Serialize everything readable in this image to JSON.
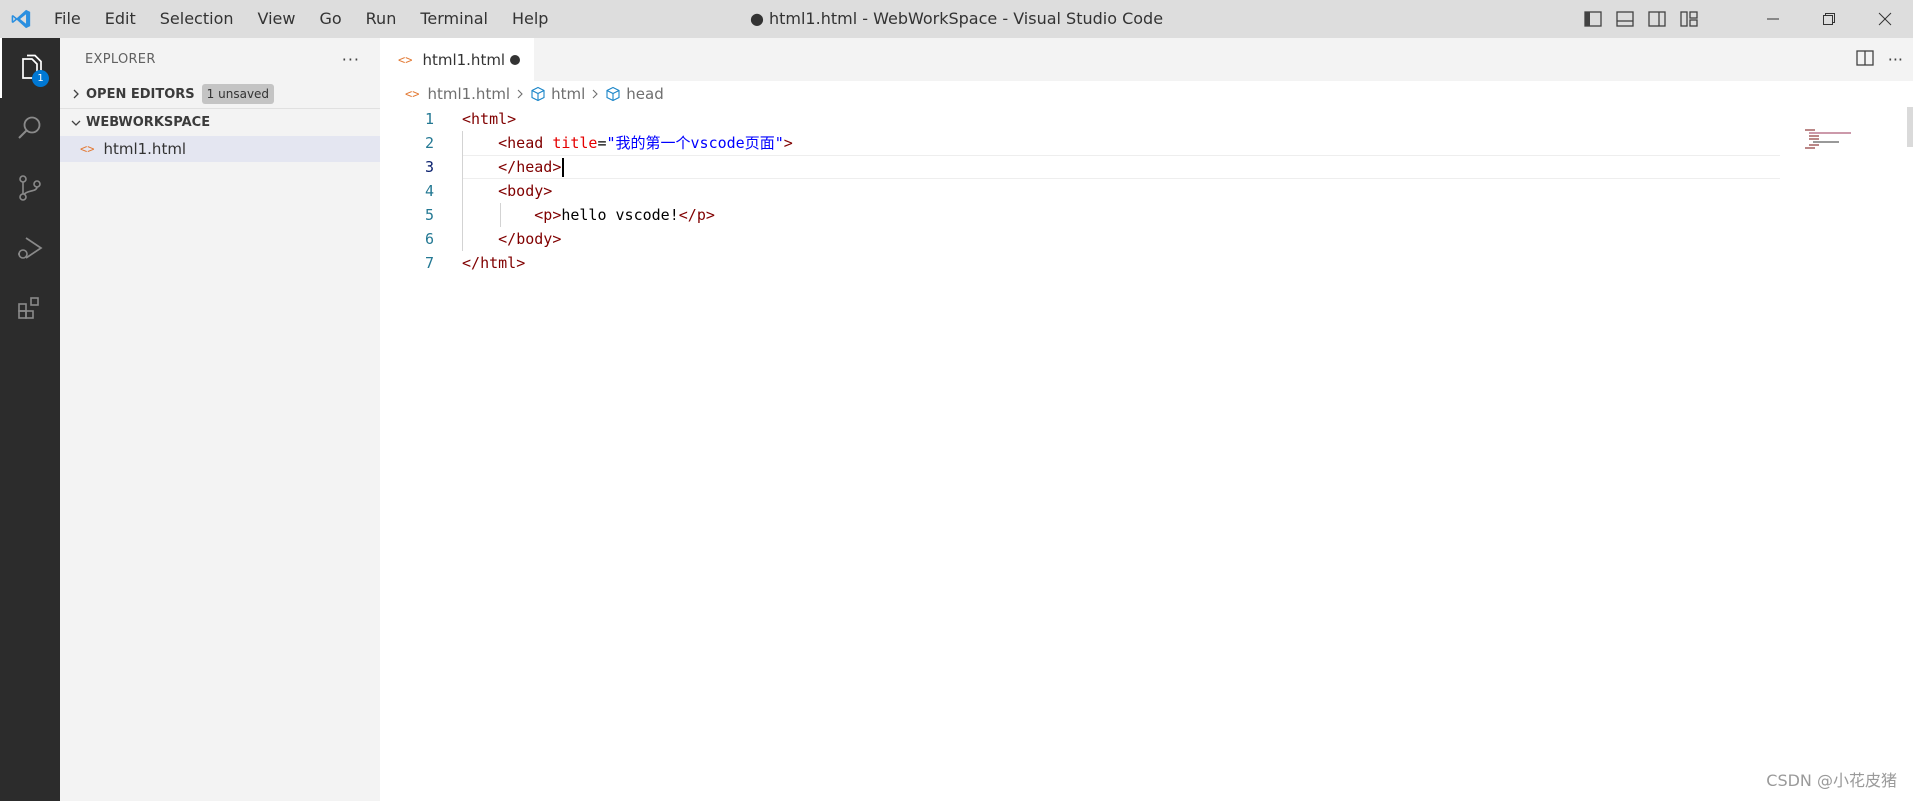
{
  "titlebar": {
    "menu": [
      "File",
      "Edit",
      "Selection",
      "View",
      "Go",
      "Run",
      "Terminal",
      "Help"
    ],
    "window_title": "● html1.html - WebWorkSpace - Visual Studio Code"
  },
  "activity_bar": {
    "items": [
      "explorer-icon",
      "search-icon",
      "source-control-icon",
      "run-debug-icon",
      "extensions-icon"
    ],
    "explorer_badge": "1"
  },
  "sidebar": {
    "title": "EXPLORER",
    "more": "···",
    "open_editors": {
      "label": "OPEN EDITORS",
      "badge": "1 unsaved"
    },
    "workspace": {
      "label": "WEBWORKSPACE"
    },
    "files": [
      {
        "icon": "<>",
        "name": "html1.html"
      }
    ]
  },
  "editor": {
    "tab": {
      "icon": "<>",
      "label": "html1.html"
    },
    "breadcrumbs": [
      "html1.html",
      "html",
      "head"
    ],
    "lines": [
      {
        "num": "1"
      },
      {
        "num": "2",
        "attr_value": "\"我的第一个vscode页面\""
      },
      {
        "num": "3"
      },
      {
        "num": "4"
      },
      {
        "num": "5",
        "text": "hello vscode!"
      },
      {
        "num": "6"
      },
      {
        "num": "7"
      }
    ]
  },
  "watermark": "CSDN @小花皮猪",
  "colors": {
    "activity_bar_bg": "#2c2c2c",
    "sidebar_bg": "#f3f3f3",
    "titlebar_bg": "#dddddd",
    "accent": "#0078d4",
    "tag": "#800000",
    "attribute": "#e50000",
    "string": "#0000ff"
  }
}
